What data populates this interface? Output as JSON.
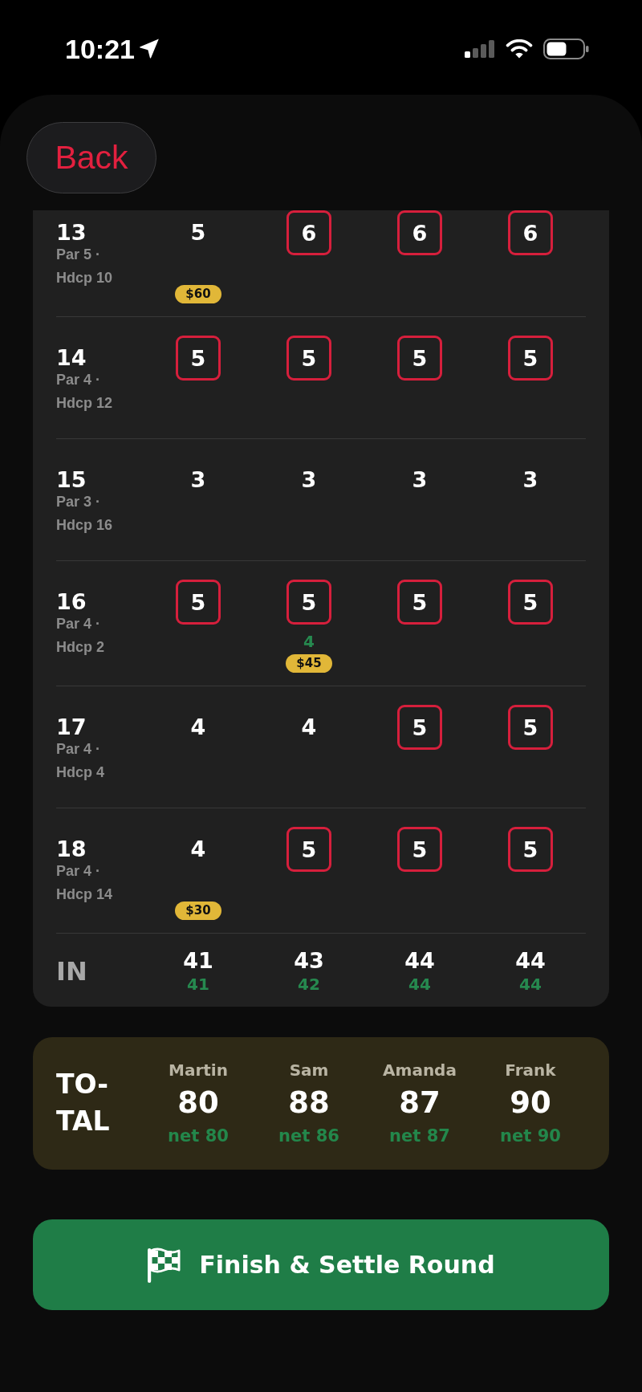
{
  "status_bar": {
    "time": "10:21"
  },
  "back_button": {
    "label": "Back"
  },
  "scorecard": {
    "holes": [
      {
        "number": "13",
        "info": "Par 5 · Hdcp 10",
        "scores": [
          {
            "gross": "5",
            "bogey": false,
            "skin": "$60"
          },
          {
            "gross": "6",
            "bogey": true
          },
          {
            "gross": "6",
            "bogey": true
          },
          {
            "gross": "6",
            "bogey": true
          }
        ]
      },
      {
        "number": "14",
        "info": "Par 4 · Hdcp 12",
        "scores": [
          {
            "gross": "5",
            "bogey": true
          },
          {
            "gross": "5",
            "bogey": true
          },
          {
            "gross": "5",
            "bogey": true
          },
          {
            "gross": "5",
            "bogey": true
          }
        ]
      },
      {
        "number": "15",
        "info": "Par 3 · Hdcp 16",
        "scores": [
          {
            "gross": "3",
            "bogey": false
          },
          {
            "gross": "3",
            "bogey": false
          },
          {
            "gross": "3",
            "bogey": false
          },
          {
            "gross": "3",
            "bogey": false
          }
        ]
      },
      {
        "number": "16",
        "info": "Par 4 · Hdcp 2",
        "scores": [
          {
            "gross": "5",
            "bogey": true
          },
          {
            "gross": "5",
            "bogey": true,
            "net": "4",
            "skin": "$45"
          },
          {
            "gross": "5",
            "bogey": true
          },
          {
            "gross": "5",
            "bogey": true
          }
        ]
      },
      {
        "number": "17",
        "info": "Par 4 · Hdcp 4",
        "scores": [
          {
            "gross": "4",
            "bogey": false
          },
          {
            "gross": "4",
            "bogey": false
          },
          {
            "gross": "5",
            "bogey": true
          },
          {
            "gross": "5",
            "bogey": true
          }
        ]
      },
      {
        "number": "18",
        "info": "Par 4 · Hdcp 14",
        "scores": [
          {
            "gross": "4",
            "bogey": false,
            "skin": "$30"
          },
          {
            "gross": "5",
            "bogey": true
          },
          {
            "gross": "5",
            "bogey": true
          },
          {
            "gross": "5",
            "bogey": true
          }
        ]
      }
    ],
    "in_row": {
      "label": "IN",
      "totals": [
        {
          "gross": "41",
          "net": "41"
        },
        {
          "gross": "43",
          "net": "42"
        },
        {
          "gross": "44",
          "net": "44"
        },
        {
          "gross": "44",
          "net": "44"
        }
      ]
    }
  },
  "total": {
    "label": "TO-TAL",
    "players": [
      {
        "name": "Martin",
        "gross": "80",
        "net": "net 80"
      },
      {
        "name": "Sam",
        "gross": "88",
        "net": "net 86"
      },
      {
        "name": "Amanda",
        "gross": "87",
        "net": "net 87"
      },
      {
        "name": "Frank",
        "gross": "90",
        "net": "net 90"
      }
    ]
  },
  "finish_button": {
    "label": "Finish & Settle Round"
  }
}
